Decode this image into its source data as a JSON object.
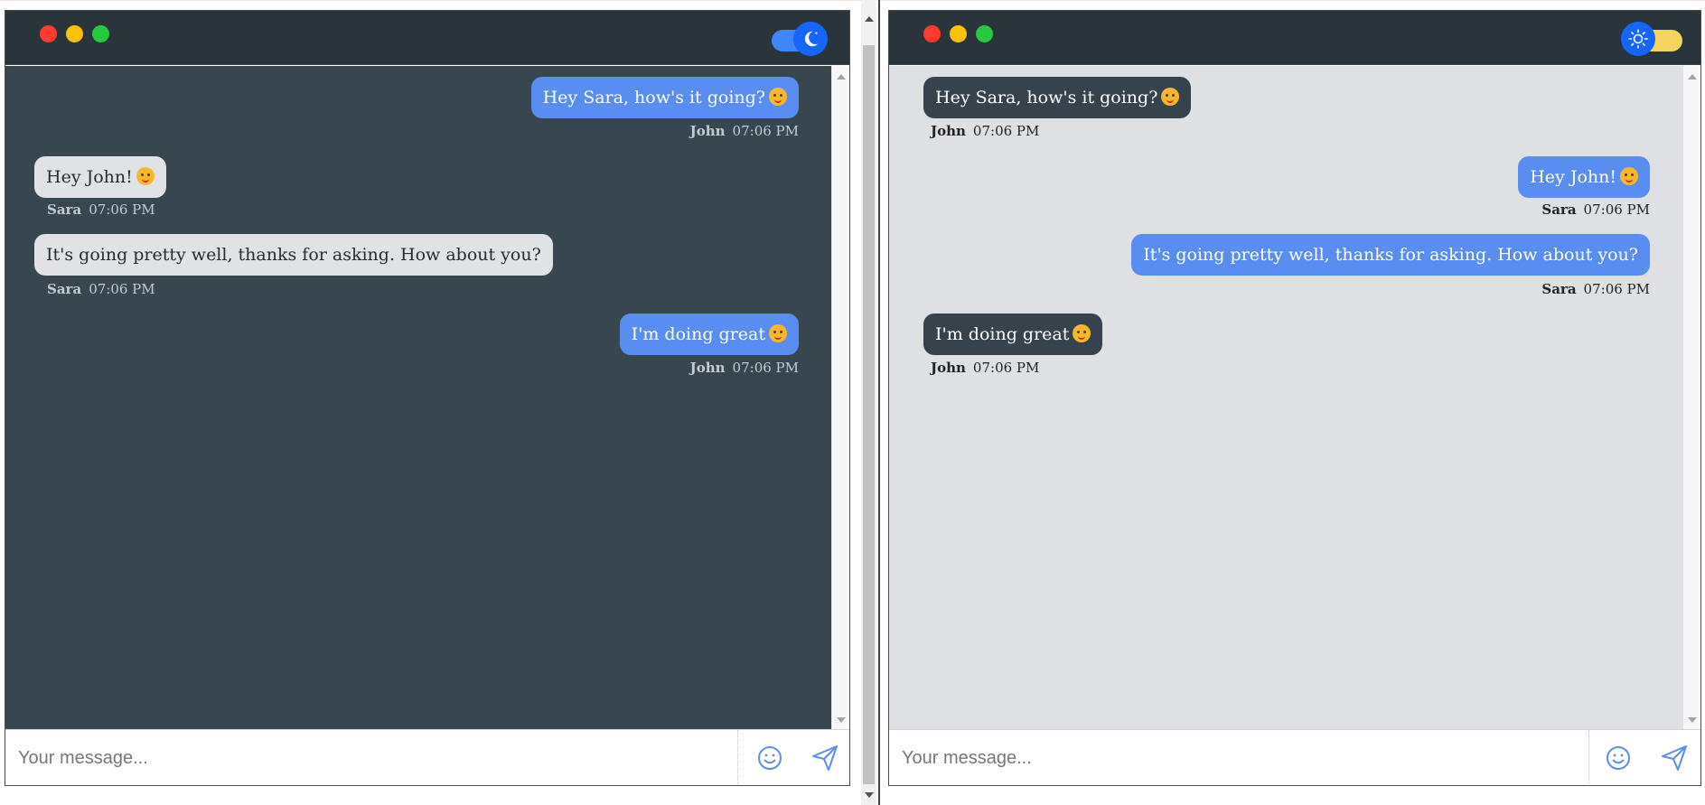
{
  "panels": {
    "left": {
      "theme": "dark",
      "toggle_icon": "moon-icon",
      "messages": [
        {
          "text": "Hey Sara, how's it going?",
          "emoji": "winking-tongue-emoji",
          "sender": "John",
          "time": "07:06 PM",
          "side": "right"
        },
        {
          "text": "Hey John!",
          "emoji": "kissing-emoji",
          "sender": "Sara",
          "time": "07:06 PM",
          "side": "left"
        },
        {
          "text": "It's going pretty well, thanks for asking. How about you?",
          "emoji": "",
          "sender": "Sara",
          "time": "07:06 PM",
          "side": "left"
        },
        {
          "text": "I'm doing great",
          "emoji": "smiling-emoji",
          "sender": "John",
          "time": "07:06 PM",
          "side": "right"
        }
      ],
      "composer": {
        "placeholder": "Your message..."
      }
    },
    "right": {
      "theme": "light",
      "toggle_icon": "sun-icon",
      "messages": [
        {
          "text": "Hey Sara, how's it going?",
          "emoji": "winking-tongue-emoji",
          "sender": "John",
          "time": "07:06 PM",
          "side": "left"
        },
        {
          "text": "Hey John!",
          "emoji": "kissing-emoji",
          "sender": "Sara",
          "time": "07:06 PM",
          "side": "right"
        },
        {
          "text": "It's going pretty well, thanks for asking. How about you?",
          "emoji": "",
          "sender": "Sara",
          "time": "07:06 PM",
          "side": "right"
        },
        {
          "text": "I'm doing great",
          "emoji": "smiling-emoji",
          "sender": "John",
          "time": "07:06 PM",
          "side": "left"
        }
      ],
      "composer": {
        "placeholder": "Your message..."
      }
    }
  },
  "colors": {
    "dark_bg": "#37464f",
    "light_bg": "#dfe0e4",
    "accent_blue": "#5a8df0",
    "titlebar": "#2a343b",
    "traffic_red": "#ff3b30",
    "traffic_yellow": "#ffc107",
    "traffic_green": "#28c840"
  }
}
